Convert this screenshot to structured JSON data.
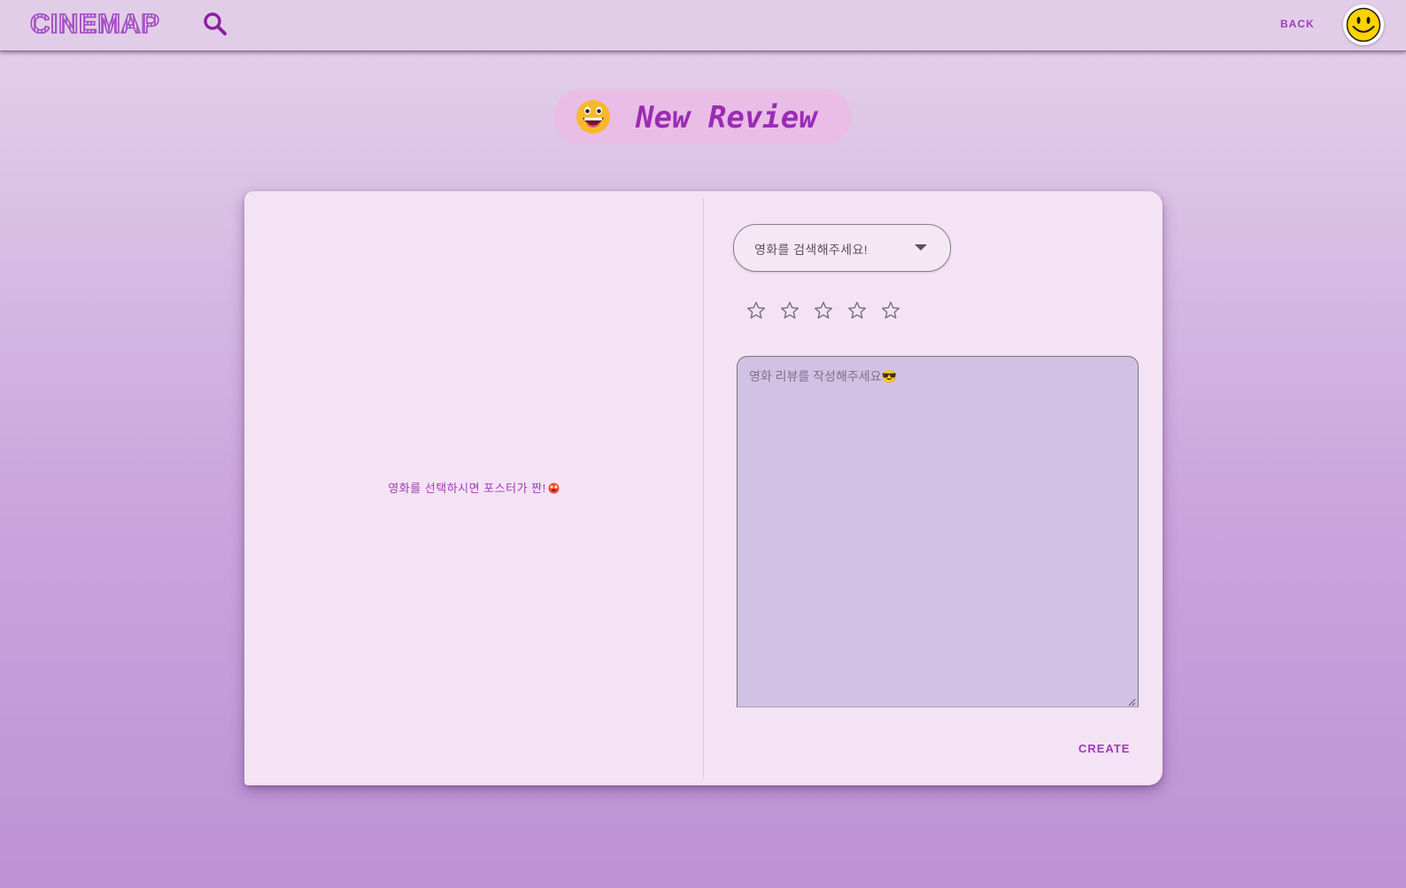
{
  "header": {
    "logo": "CINEMAP",
    "back_label": "BACK",
    "search_icon": "search-icon",
    "avatar_icon": "smiley-face-icon"
  },
  "page": {
    "title": "New Review",
    "title_icon": "grinning-face-emoji"
  },
  "form": {
    "poster_hint": "영화를 선택하시면 포스터가 짠!",
    "poster_hint_icon": "heart-eyes-emoji",
    "movie_select_placeholder": "영화를 검색해주세요!",
    "rating": {
      "max": 5,
      "value": 0
    },
    "review_placeholder": "영화 리뷰를 작성해주세요😎",
    "create_label": "CREATE"
  },
  "colors": {
    "accent": "#9c3fb8",
    "card_bg": "#f3e3f4",
    "textarea_bg": "#d1c2e5",
    "appbar_bg": "#e2cde9"
  }
}
